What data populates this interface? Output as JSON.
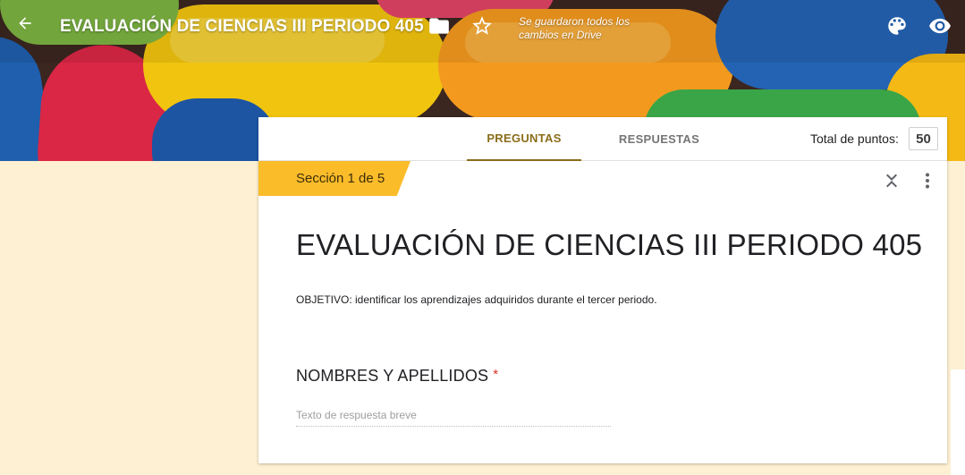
{
  "header": {
    "title": "EVALUACIÓN DE CIENCIAS III PERIODO 405",
    "save_status": "Se guardaron todos los cambios en Drive",
    "icons": {
      "back": "arrow-back-icon",
      "folder": "folder-icon",
      "star": "star-icon",
      "palette": "palette-icon",
      "preview": "eye-icon"
    }
  },
  "tabs": [
    {
      "label": "PREGUNTAS",
      "active": true
    },
    {
      "label": "RESPUESTAS",
      "active": false
    }
  ],
  "points": {
    "label": "Total de puntos:",
    "value": "50"
  },
  "section": {
    "tag": "Sección 1 de 5",
    "title": "EVALUACIÓN DE CIENCIAS III PERIODO 405",
    "description": "OBJETIVO: identificar los aprendizajes adquiridos durante el tercer periodo."
  },
  "question": {
    "title": "NOMBRES Y APELLIDOS",
    "required_mark": "*",
    "placeholder": "Texto de respuesta breve"
  },
  "colors": {
    "page_background": "#fdf0d3",
    "accent": "#8a6d1a",
    "section_tag": "#fbbc2a",
    "required": "#d93025"
  }
}
